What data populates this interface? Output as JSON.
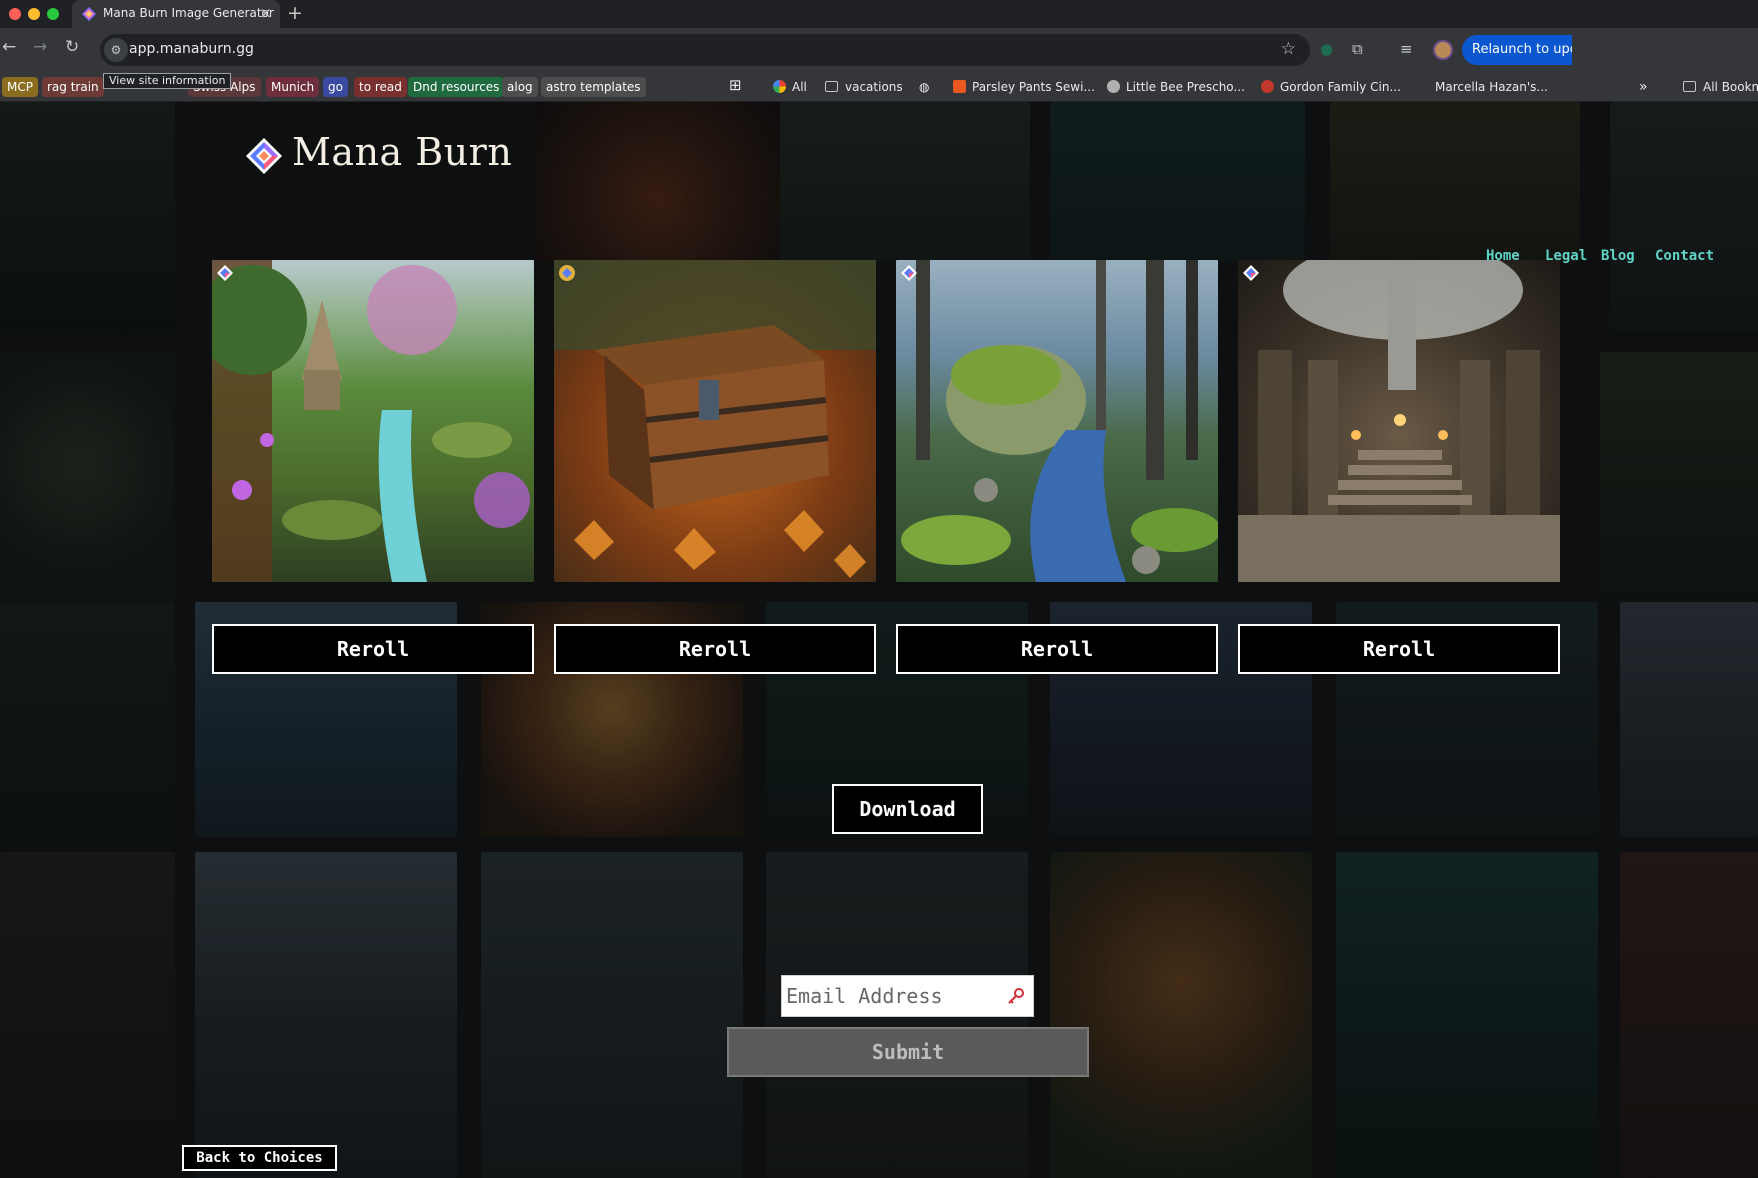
{
  "browser": {
    "tab_title": "Mana Burn Image Generator",
    "tab_favicon": "mana-burn-gem-icon",
    "url": "app.manaburn.gg",
    "site_info_tooltip": "View site information",
    "relaunch_label": "Relaunch to update",
    "bookmarks": [
      {
        "label": "MCP",
        "color": "#8a6d1e"
      },
      {
        "label": "rag train",
        "color": "#6e3a35"
      },
      {
        "label": "Swiss Alps",
        "color": "#5c3838"
      },
      {
        "label": "Munich",
        "color": "#6e2e3c"
      },
      {
        "label": "go",
        "color": "#3a4aa0"
      },
      {
        "label": "to read",
        "color": "#7a2f2f"
      },
      {
        "label": "Dnd resources",
        "color": "#1f6b3f"
      },
      {
        "label": "alog",
        "color": "#4d4d4d"
      },
      {
        "label": "astro templates",
        "color": "#4d4d4d"
      }
    ],
    "bookmark_links": [
      "All",
      "vacations",
      "Parsley Pants Sewi...",
      "Little Bee Prescho...",
      "Gordon Family Cin...",
      "Marcella Hazan's..."
    ],
    "all_bookmarks_label": "All Bookmarks"
  },
  "site": {
    "logo_text": "Mana Burn",
    "nav": [
      "Home",
      "Legal",
      "Blog",
      "Contact"
    ],
    "accent_color": "#5fd4c8"
  },
  "generated_images": [
    {
      "scene": "forest waterfall with stone shrine",
      "reroll_label": "Reroll"
    },
    {
      "scene": "wooden treasure chest on autumn leaves",
      "reroll_label": "Reroll"
    },
    {
      "scene": "misty forest stream with mossy boulder",
      "reroll_label": "Reroll"
    },
    {
      "scene": "stone temple hall with staircase",
      "reroll_label": "Reroll"
    }
  ],
  "download_label": "Download",
  "email": {
    "placeholder": "Email Address",
    "value": ""
  },
  "submit_label": "Submit",
  "back_label": "Back to Choices"
}
